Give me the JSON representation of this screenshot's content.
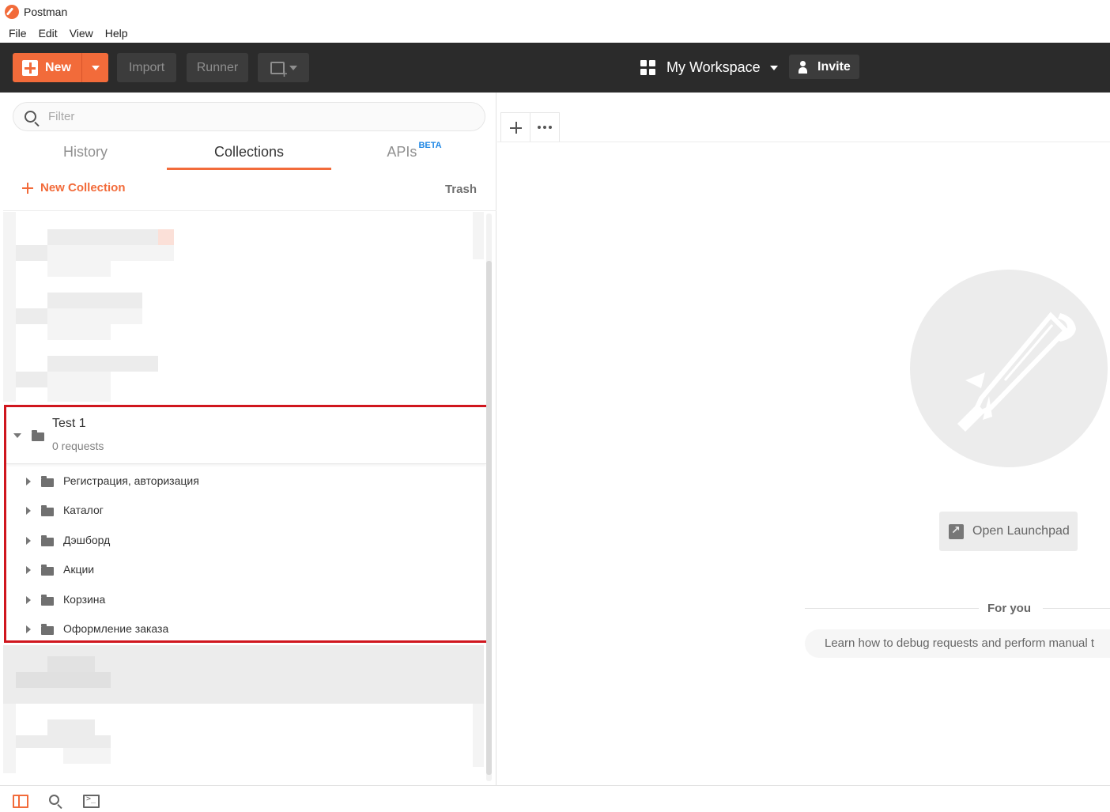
{
  "app": {
    "title": "Postman"
  },
  "menu": [
    "File",
    "Edit",
    "View",
    "Help"
  ],
  "toolbar": {
    "new_label": "New",
    "import_label": "Import",
    "runner_label": "Runner",
    "workspace_label": "My Workspace",
    "invite_label": "Invite"
  },
  "sidebar": {
    "search_placeholder": "Filter",
    "tabs": {
      "history": "History",
      "collections": "Collections",
      "apis": "APIs",
      "apis_badge": "BETA"
    },
    "new_collection_label": "New Collection",
    "trash_label": "Trash",
    "active_tab": "Collections"
  },
  "collection": {
    "name": "Test 1",
    "subtitle": "0 requests",
    "folders": [
      "Регистрация, авторизация",
      "Каталог",
      "Дэшборд",
      "Акции",
      "Корзина",
      "Оформление заказа"
    ]
  },
  "main": {
    "launchpad_label": "Open Launchpad",
    "for_you_label": "For you",
    "learn_text": "Learn how to debug requests and perform manual t"
  },
  "colors": {
    "accent": "#f26b3a",
    "header": "#2b2b2b",
    "highlight_border": "#d0161e"
  }
}
